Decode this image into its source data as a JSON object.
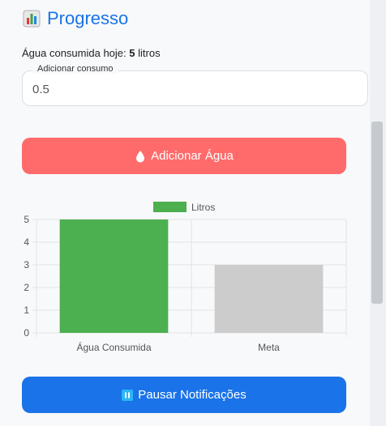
{
  "header": {
    "title": "Progresso",
    "icon": "bar-chart-icon"
  },
  "summary": {
    "prefix": "Água consumida hoje:",
    "value": "5",
    "unit": "litros"
  },
  "consumo_field": {
    "legend": "Adicionar consumo",
    "value": "0.5"
  },
  "add_button": {
    "label": "Adicionar Água",
    "icon": "droplet-icon",
    "color": "#ff6b6b"
  },
  "pause_button": {
    "label": "Pausar Notificações",
    "icon": "pause-icon",
    "color": "#1a73e8"
  },
  "chart_data": {
    "type": "bar",
    "categories": [
      "Água Consumida",
      "Meta"
    ],
    "series": [
      {
        "name": "Litros",
        "values": [
          5,
          3
        ]
      }
    ],
    "bar_colors": [
      "#4caf50",
      "#cccccc"
    ],
    "legend_color": "#4caf50",
    "ylim": [
      0,
      5
    ],
    "yticks": [
      "0",
      "1",
      "2",
      "3",
      "4",
      "5"
    ],
    "legend": "top",
    "grid": true
  }
}
